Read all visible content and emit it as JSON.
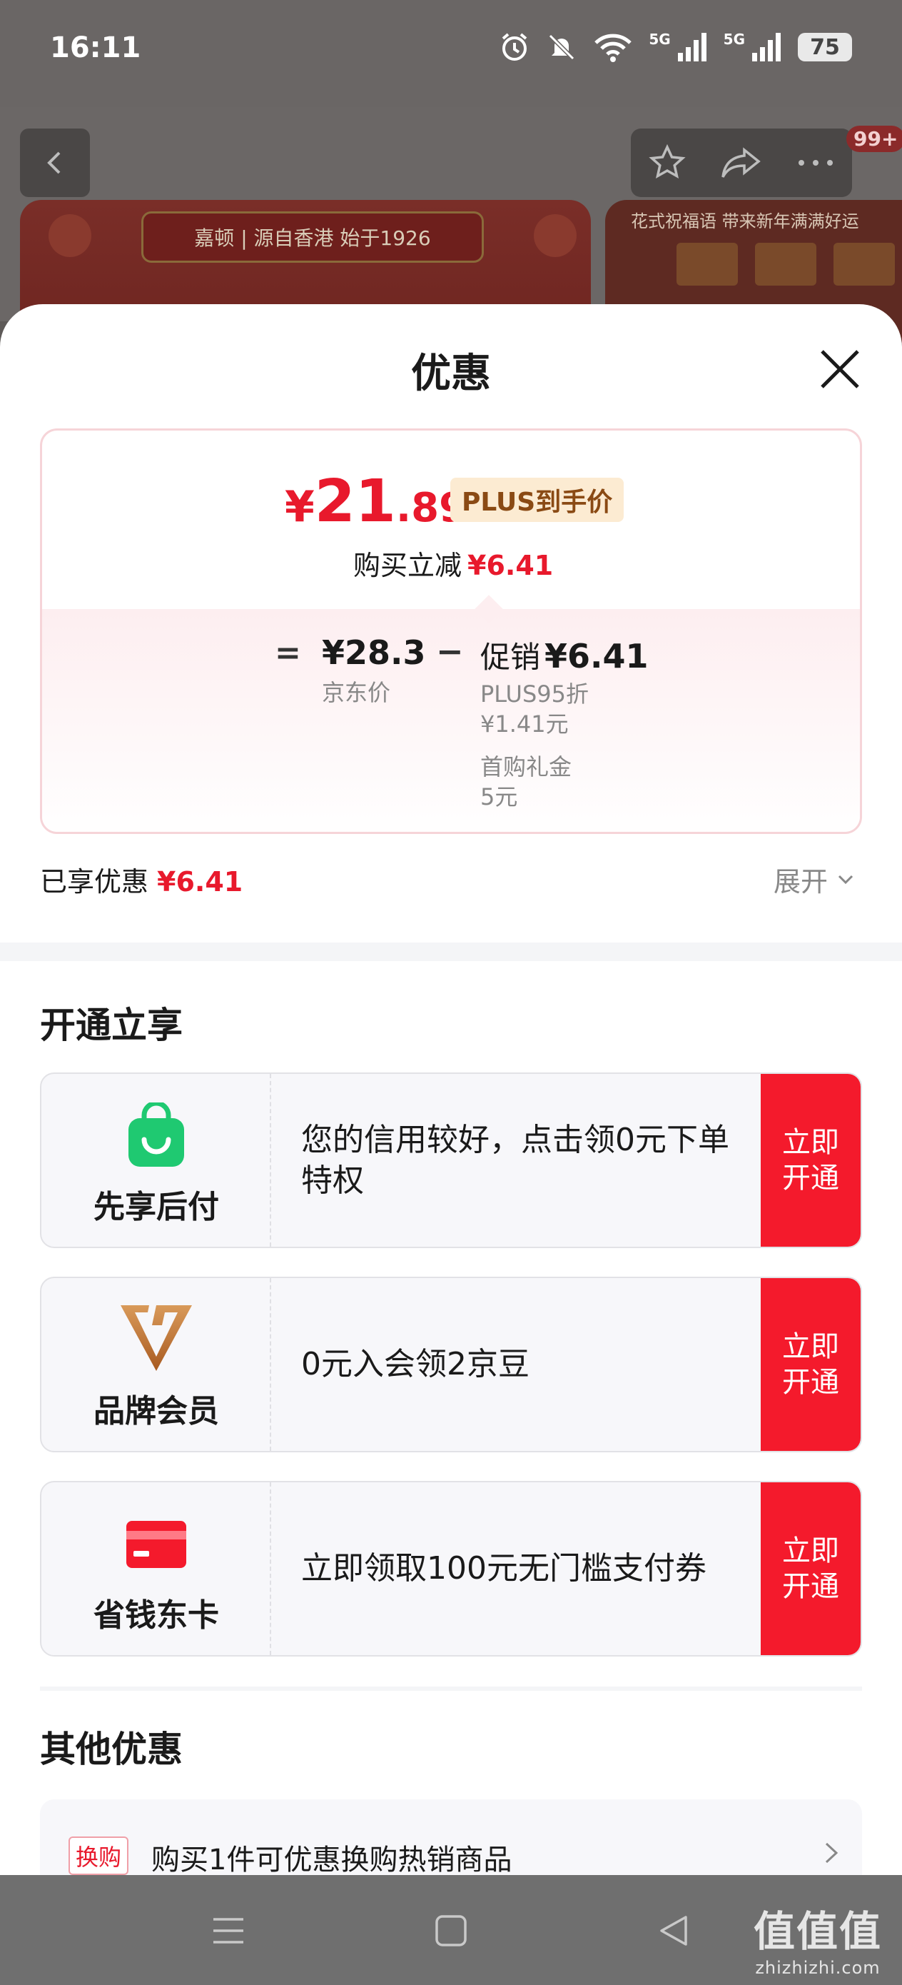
{
  "status_bar": {
    "time": "16:11",
    "net1": "5G",
    "net2": "5G",
    "battery": "75"
  },
  "background_page": {
    "badge": "99+",
    "banner_left_text": "嘉顿 | 源自香港 始于1926",
    "banner_right_text": "花式祝福语 带来新年满满好运"
  },
  "sheet": {
    "title": "优惠",
    "price": {
      "symbol": "¥",
      "integer": "21",
      "decimal": ".89",
      "tag": "PLUS到手价",
      "buy_reduce_label": "购买立减",
      "buy_reduce_value": "¥6.41"
    },
    "breakdown": {
      "equals": "=",
      "jd_price": "¥28.3",
      "jd_label": "京东价",
      "minus": "−",
      "promo_label": "促销",
      "promo_value": "¥6.41",
      "items": [
        {
          "name": "PLUS95折",
          "value": "¥1.41元"
        },
        {
          "name": "首购礼金",
          "value": "5元"
        }
      ]
    },
    "enjoyed_label": "已享优惠",
    "enjoyed_value": "¥6.41",
    "expand_label": "展开",
    "open_section_title": "开通立享",
    "offers": [
      {
        "name": "先享后付",
        "icon": "shopping-bag-icon",
        "desc": "您的信用较好，点击领0元下单特权",
        "cta": "立即开通"
      },
      {
        "name": "品牌会员",
        "icon": "brand-v-icon",
        "desc": "0元入会领2京豆",
        "cta": "立即开通"
      },
      {
        "name": "省钱东卡",
        "icon": "card-icon",
        "desc": "立即领取100元无门槛支付券",
        "cta": "立即开通"
      }
    ],
    "other_section_title": "其他优惠",
    "other_items": [
      {
        "tag": "换购",
        "text": "购买1件可优惠换购热销商品"
      }
    ]
  },
  "watermark": {
    "big": "值值值",
    "small": "zhizhizhi.com"
  },
  "colors": {
    "accent_red": "#e8192c",
    "cta_red": "#f41a2c",
    "plus_tag_bg": "#fcebd2",
    "green_bag": "#1fc971"
  }
}
